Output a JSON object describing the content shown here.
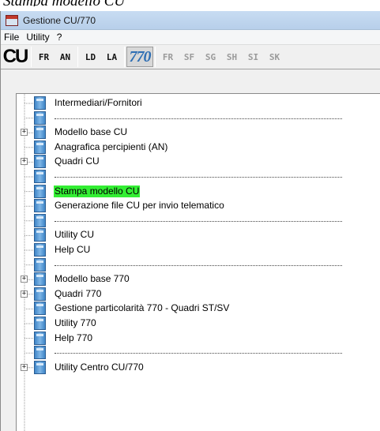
{
  "page_heading": "Stampa modello CU",
  "window": {
    "title": "Gestione CU/770"
  },
  "menu": [
    "File",
    "Utility",
    "?"
  ],
  "toolbar": {
    "cu_logo": "CU",
    "left_buttons": [
      "FR",
      "AN",
      "LD",
      "LA"
    ],
    "logo_770": "770",
    "right_buttons": [
      "FR",
      "SF",
      "SG",
      "SH",
      "SI",
      "SK"
    ]
  },
  "tree": {
    "items": [
      {
        "label": "Intermediari/Fornitori",
        "expandable": false,
        "separator": false
      },
      {
        "label": "",
        "expandable": false,
        "separator": true
      },
      {
        "label": "Modello base CU",
        "expandable": true,
        "separator": false
      },
      {
        "label": "Anagrafica percipienti (AN)",
        "expandable": false,
        "separator": false
      },
      {
        "label": "Quadri CU",
        "expandable": true,
        "separator": false
      },
      {
        "label": "",
        "expandable": false,
        "separator": true
      },
      {
        "label": "Stampa modello CU",
        "expandable": false,
        "separator": false,
        "selected": true
      },
      {
        "label": "Generazione file CU per invio telematico",
        "expandable": false,
        "separator": false
      },
      {
        "label": "",
        "expandable": false,
        "separator": true
      },
      {
        "label": "Utility CU",
        "expandable": false,
        "separator": false
      },
      {
        "label": "Help CU",
        "expandable": false,
        "separator": false
      },
      {
        "label": "",
        "expandable": false,
        "separator": true
      },
      {
        "label": "Modello base 770",
        "expandable": true,
        "separator": false
      },
      {
        "label": "Quadri 770",
        "expandable": true,
        "separator": false
      },
      {
        "label": "Gestione particolarità 770 - Quadri ST/SV",
        "expandable": false,
        "separator": false
      },
      {
        "label": "Utility 770",
        "expandable": false,
        "separator": false
      },
      {
        "label": "Help 770",
        "expandable": false,
        "separator": false
      },
      {
        "label": "",
        "expandable": false,
        "separator": true
      },
      {
        "label": "Utility Centro CU/770",
        "expandable": true,
        "separator": false
      }
    ]
  }
}
